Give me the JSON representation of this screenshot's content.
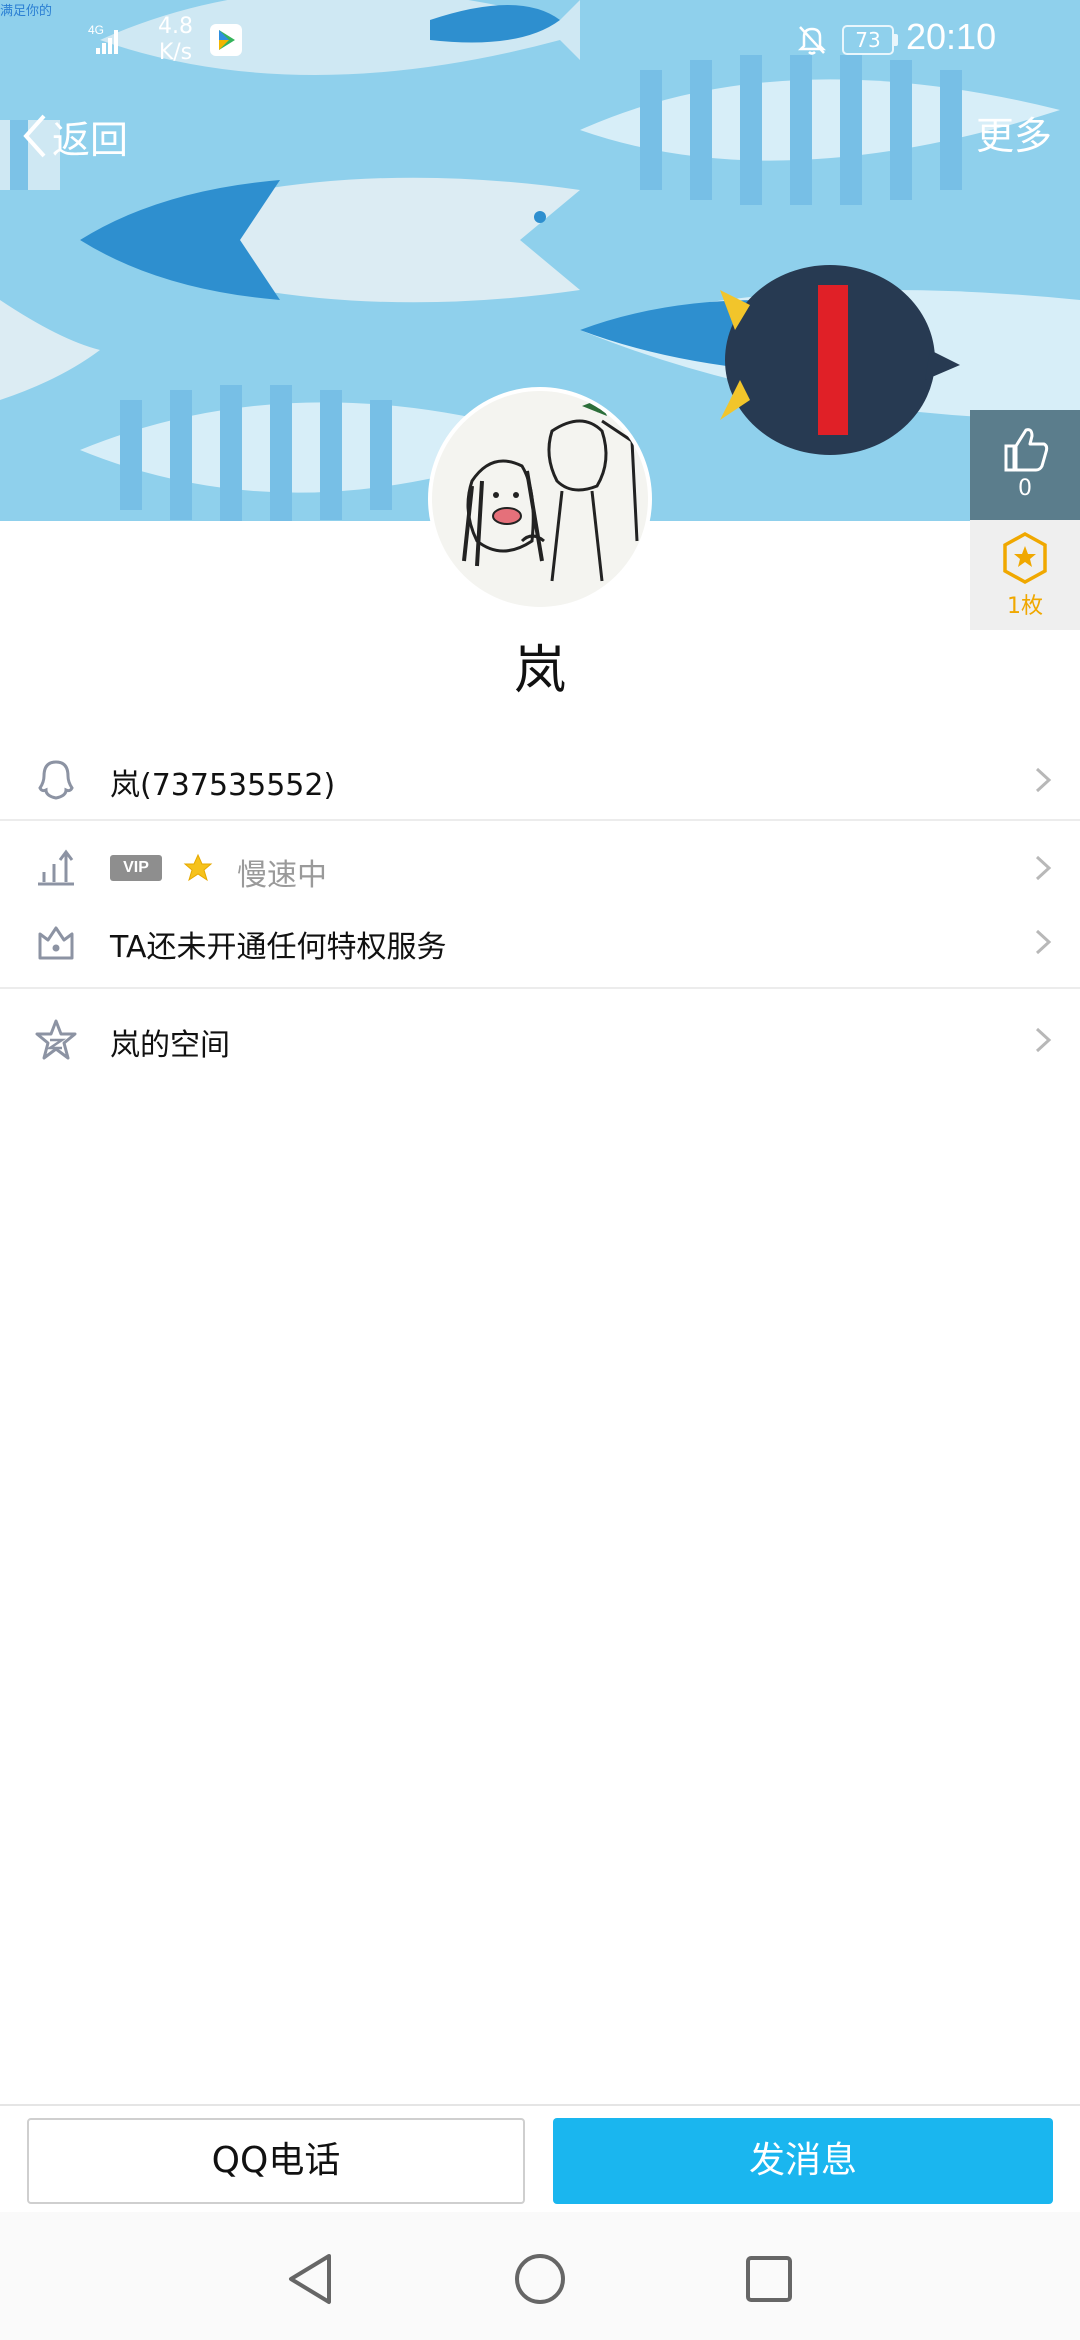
{
  "status_bar": {
    "top_left_text": "满足你的",
    "signal_label": "4G",
    "net_speed_value": "4.8",
    "net_speed_unit": "K/s",
    "battery": "73",
    "time": "20:10"
  },
  "nav": {
    "back_label": "返回",
    "more_label": "更多"
  },
  "side": {
    "likes": "0",
    "coins": "1枚"
  },
  "profile": {
    "name": "岚"
  },
  "rows": {
    "qq": "岚(737535552)",
    "vip_badge": "VIP",
    "vip_status": "慢速中",
    "privilege": "TA还未开通任何特权服务",
    "space": "岚的空间"
  },
  "actions": {
    "call": "QQ电话",
    "message": "发消息"
  },
  "colors": {
    "header_bg": "#8fd0ec",
    "primary_button": "#1ab6ef",
    "coin": "#f0a800"
  }
}
